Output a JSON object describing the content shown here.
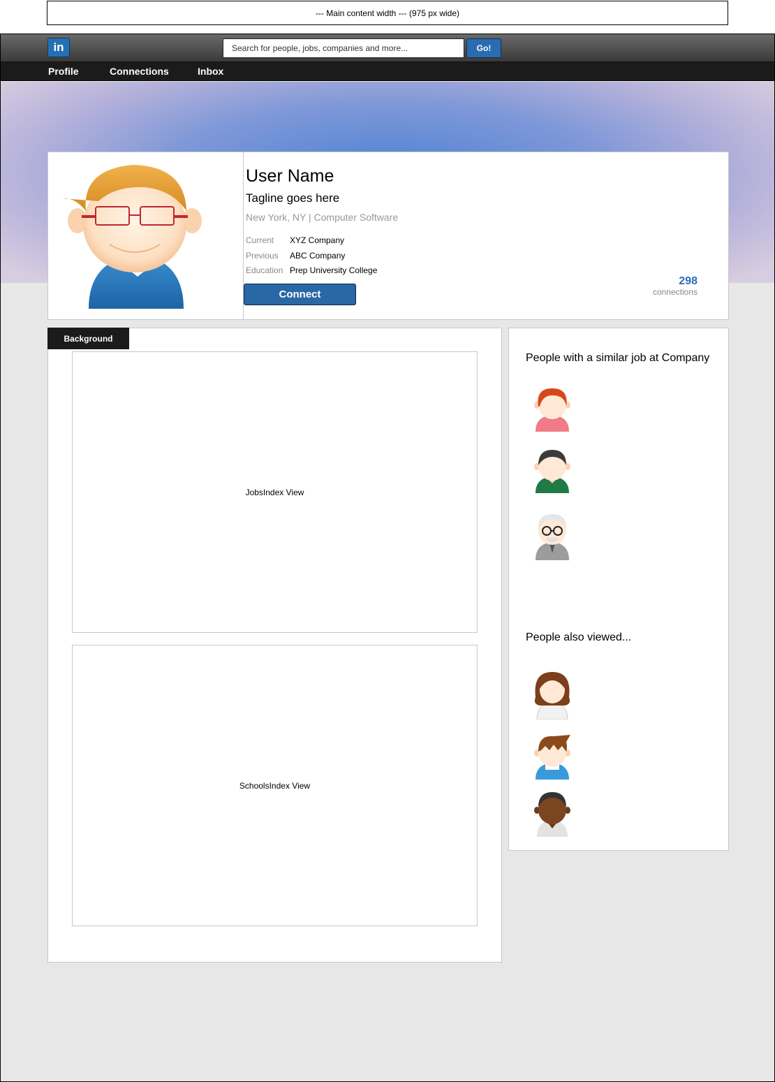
{
  "width_note": "--- Main content width --- (975 px wide)",
  "header": {
    "logo_text": "in",
    "search_placeholder": "Search for people, jobs, companies and more...",
    "go_label": "Go!"
  },
  "nav": {
    "items": [
      "Profile",
      "Connections",
      "Inbox"
    ]
  },
  "profile": {
    "name": "User Name",
    "tagline": "Tagline goes here",
    "location": "New York, NY | Computer Software",
    "details": [
      {
        "label": "Current",
        "value": "XYZ Company"
      },
      {
        "label": "Previous",
        "value": "ABC Company"
      },
      {
        "label": "Education",
        "value": "Prep University College"
      }
    ],
    "connect_label": "Connect",
    "connections_count": "298",
    "connections_label": "connections"
  },
  "background": {
    "tab_label": "Background",
    "jobs_view": "JobsIndex View",
    "schools_view": "SchoolsIndex View"
  },
  "sidebar": {
    "similar_heading": "People with a similar job at Company",
    "similar_people": [
      "redhead-woman-avatar",
      "dark-hair-man-avatar",
      "elderly-man-avatar"
    ],
    "viewed_heading": "People also viewed...",
    "viewed_people": [
      "brunette-woman-avatar",
      "boy-avatar",
      "dark-skin-man-avatar"
    ]
  },
  "colors": {
    "brand_blue": "#2a6cb0",
    "nav_dark": "#1b1b1b",
    "page_bg": "#e7e7e7"
  }
}
